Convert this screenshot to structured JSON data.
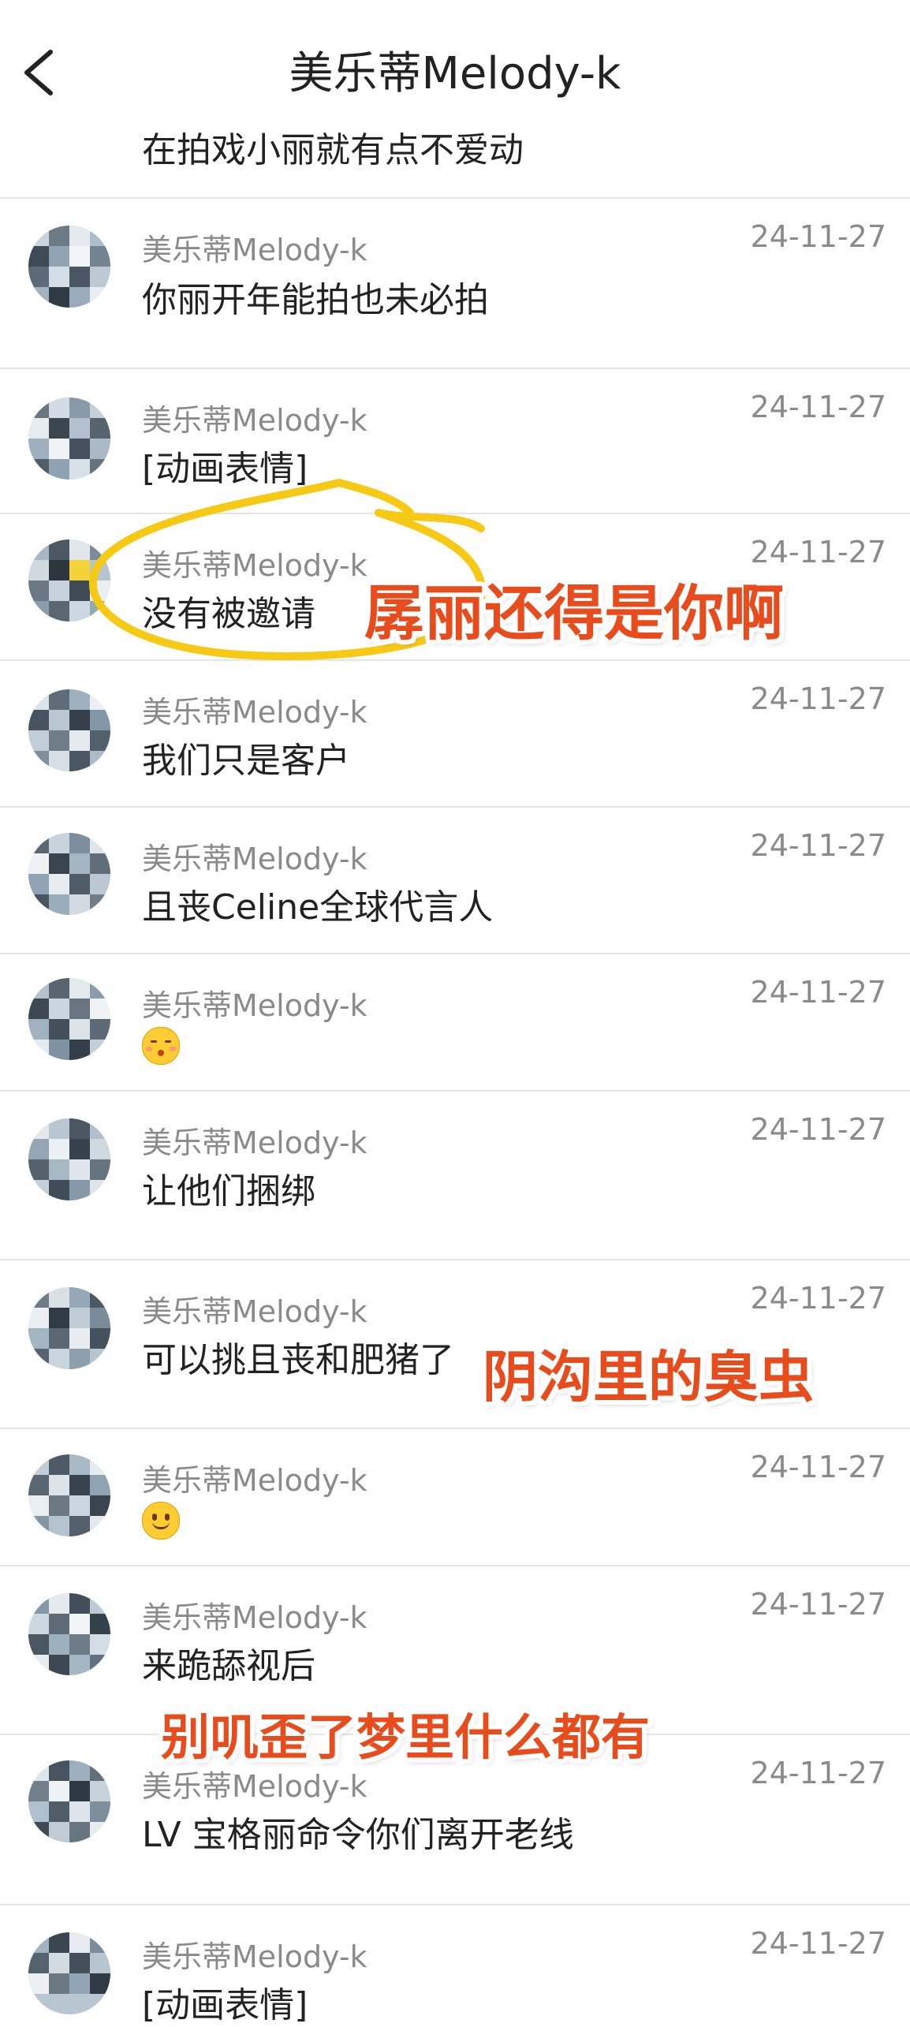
{
  "header": {
    "title": "美乐蒂Melody-k"
  },
  "partial_top": {
    "message": "在拍戏小丽就有点不爱动"
  },
  "messages": [
    {
      "name": "美乐蒂Melody-k",
      "date": "24-11-27",
      "text": "你丽开年能拍也未必拍"
    },
    {
      "name": "美乐蒂Melody-k",
      "date": "24-11-27",
      "text": "[动画表情]"
    },
    {
      "name": "美乐蒂Melody-k",
      "date": "24-11-27",
      "text": "没有被邀请"
    },
    {
      "name": "美乐蒂Melody-k",
      "date": "24-11-27",
      "text": "我们只是客户"
    },
    {
      "name": "美乐蒂Melody-k",
      "date": "24-11-27",
      "text": "且丧Celine全球代言人"
    },
    {
      "name": "美乐蒂Melody-k",
      "date": "24-11-27",
      "emoji": "kissing-face-emoji"
    },
    {
      "name": "美乐蒂Melody-k",
      "date": "24-11-27",
      "text": "让他们捆绑"
    },
    {
      "name": "美乐蒂Melody-k",
      "date": "24-11-27",
      "text": "可以挑且丧和肥猪了"
    },
    {
      "name": "美乐蒂Melody-k",
      "date": "24-11-27",
      "emoji": "slight-smile-emoji"
    },
    {
      "name": "美乐蒂Melody-k",
      "date": "24-11-27",
      "text": "来跪舔视后"
    },
    {
      "name": "美乐蒂Melody-k",
      "date": "24-11-27",
      "text": "LV 宝格丽命令你们离开老线"
    },
    {
      "name": "美乐蒂Melody-k",
      "date": "24-11-27",
      "text": "[动画表情]"
    }
  ],
  "annotations": {
    "caption_1": "孱丽还得是你啊",
    "caption_2": "阴沟里的臭虫",
    "caption_3": "别叽歪了梦里什么都有",
    "accent_color": "#e84c1c",
    "circle_color": "#f6c915"
  }
}
